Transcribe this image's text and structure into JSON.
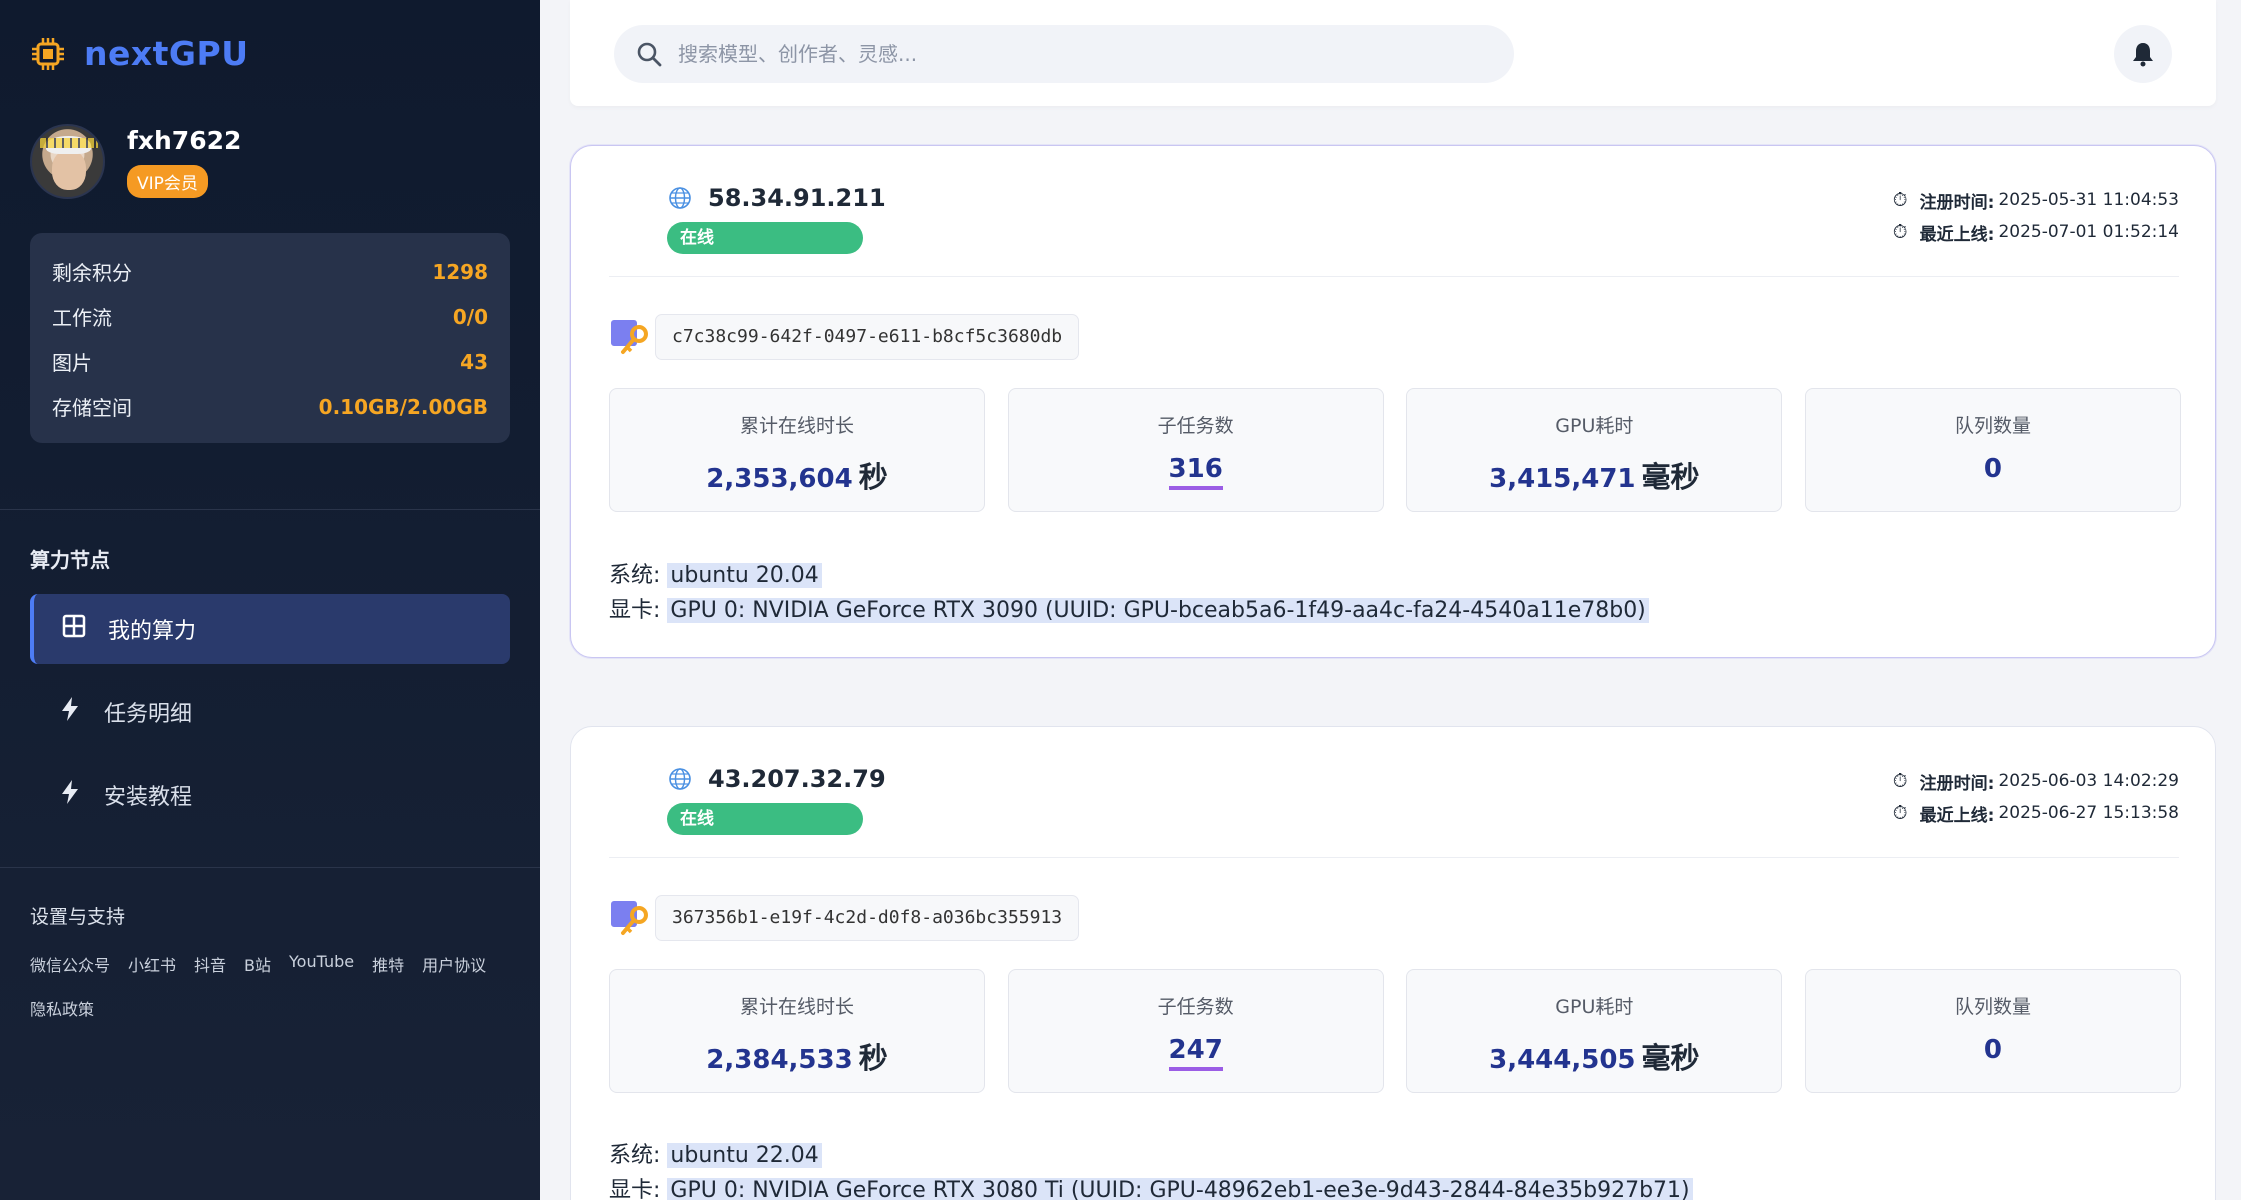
{
  "app": {
    "name": "nextGPU"
  },
  "user": {
    "name": "fxh7622",
    "badge": "VIP会员"
  },
  "stats": [
    {
      "label": "剩余积分",
      "value": "1298"
    },
    {
      "label": "工作流",
      "value": "0/0"
    },
    {
      "label": "图片",
      "value": "43"
    },
    {
      "label": "存储空间",
      "value": "0.10GB/2.00GB"
    }
  ],
  "nav": {
    "section_title": "算力节点",
    "items": [
      {
        "label": "我的算力",
        "icon": "grid-icon",
        "active": true
      },
      {
        "label": "任务明细",
        "icon": "lightning-icon"
      },
      {
        "label": "安装教程",
        "icon": "lightning-icon"
      }
    ]
  },
  "support": {
    "title": "设置与支持",
    "links": [
      "微信公众号",
      "小红书",
      "抖音",
      "B站",
      "YouTube",
      "推特",
      "用户协议",
      "隐私政策"
    ]
  },
  "search": {
    "placeholder": "搜索模型、创作者、灵感..."
  },
  "colors": {
    "accent": "#4d7cf5",
    "online": "#3bbd82",
    "vip": "#f59a23",
    "value": "#f6a623",
    "metric": "#23348f"
  },
  "nodes": [
    {
      "ip": "58.34.91.211",
      "status": "在线",
      "register_label": "注册时间:",
      "register_time": "2025-05-31 11:04:53",
      "last_online_label": "最近上线:",
      "last_online_time": "2025-07-01 01:52:14",
      "uuid": "c7c38c99-642f-0497-e611-b8cf5c3680db",
      "metrics": [
        {
          "label": "累计在线时长",
          "value": "2,353,604",
          "unit": "秒"
        },
        {
          "label": "子任务数",
          "value": "316",
          "unit": ""
        },
        {
          "label": "GPU耗时",
          "value": "3,415,471",
          "unit": "毫秒"
        },
        {
          "label": "队列数量",
          "value": "0",
          "unit": ""
        }
      ],
      "system_label": "系统:",
      "system": "ubuntu 20.04",
      "gpu_label": "显卡:",
      "gpu": "GPU 0: NVIDIA GeForce RTX 3090 (UUID: GPU-bceab5a6-1f49-aa4c-fa24-4540a11e78b0)"
    },
    {
      "ip": "43.207.32.79",
      "status": "在线",
      "register_label": "注册时间:",
      "register_time": "2025-06-03 14:02:29",
      "last_online_label": "最近上线:",
      "last_online_time": "2025-06-27 15:13:58",
      "uuid": "367356b1-e19f-4c2d-d0f8-a036bc355913",
      "metrics": [
        {
          "label": "累计在线时长",
          "value": "2,384,533",
          "unit": "秒"
        },
        {
          "label": "子任务数",
          "value": "247",
          "unit": ""
        },
        {
          "label": "GPU耗时",
          "value": "3,444,505",
          "unit": "毫秒"
        },
        {
          "label": "队列数量",
          "value": "0",
          "unit": ""
        }
      ],
      "system_label": "系统:",
      "system": "ubuntu 22.04",
      "gpu_label": "显卡:",
      "gpu": "GPU 0: NVIDIA GeForce RTX 3080 Ti (UUID: GPU-48962eb1-ee3e-9d43-2844-84e35b927b71)"
    }
  ]
}
